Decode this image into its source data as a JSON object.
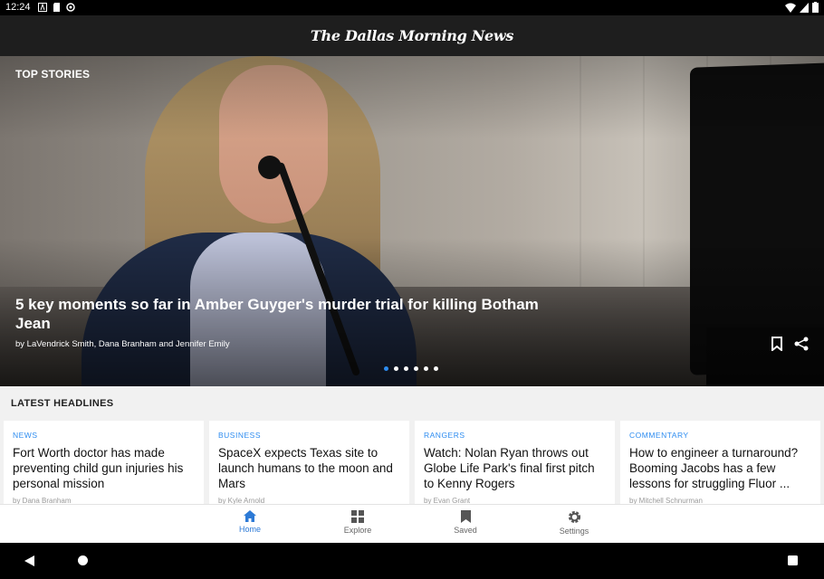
{
  "status_bar": {
    "time": "12:24"
  },
  "header": {
    "logo_text": "The Dallas Morning News"
  },
  "top_stories": {
    "label": "TOP STORIES",
    "title": "5 key moments so far in Amber Guyger's murder trial for killing Botham Jean",
    "byline": "by LaVendrick Smith, Dana Branham and Jennifer Emily",
    "carousel_total": 6,
    "carousel_active": 1
  },
  "latest": {
    "label": "LATEST HEADLINES",
    "cards": [
      {
        "category": "NEWS",
        "title": "Fort Worth doctor has made preventing child gun injuries his personal mission",
        "byline": "by Dana Branham"
      },
      {
        "category": "BUSINESS",
        "title": "SpaceX expects Texas site to launch humans to the moon and Mars",
        "byline": "by Kyle Arnold"
      },
      {
        "category": "RANGERS",
        "title": "Watch: Nolan Ryan throws out Globe Life Park's final first pitch to Kenny Rogers",
        "byline": "by Evan Grant"
      },
      {
        "category": "COMMENTARY",
        "title": "How to engineer a turnaround? Booming Jacobs has a few lessons for struggling Fluor ...",
        "byline": "by Mitchell Schnurman"
      }
    ]
  },
  "bottom_nav": {
    "items": [
      {
        "label": "Home",
        "icon": "home-icon",
        "active": true
      },
      {
        "label": "Explore",
        "icon": "grid-icon",
        "active": false
      },
      {
        "label": "Saved",
        "icon": "bookmark-icon",
        "active": false
      },
      {
        "label": "Settings",
        "icon": "gear-icon",
        "active": false
      }
    ]
  },
  "colors": {
    "accent": "#2d8cf0",
    "nav_active": "#2d7ad6",
    "header_bg": "#1e1e1e"
  }
}
